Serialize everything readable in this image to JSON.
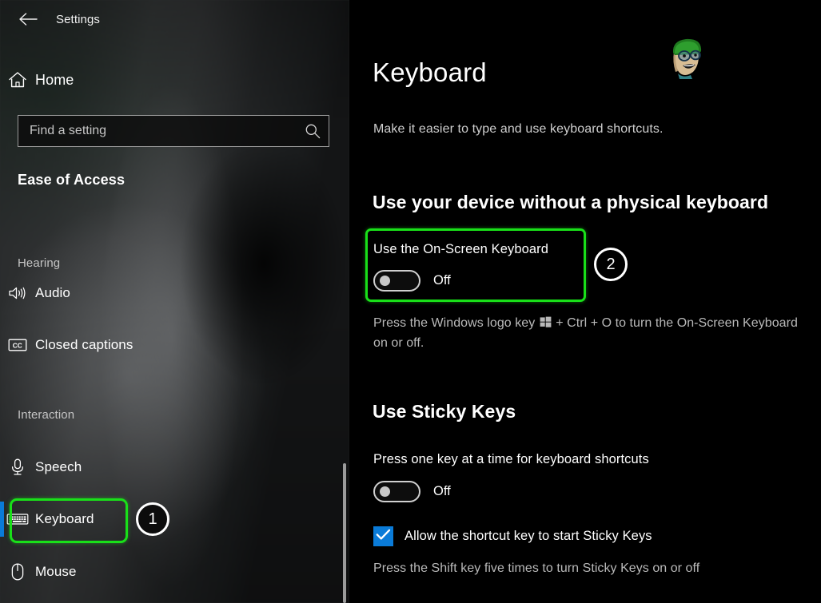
{
  "window": {
    "app_title": "Settings",
    "back_icon": "back-arrow-icon"
  },
  "sidebar": {
    "home": {
      "label": "Home",
      "icon": "home-icon"
    },
    "search": {
      "value": "",
      "placeholder": "Find a setting",
      "icon": "search-icon"
    },
    "category_title": "Ease of Access",
    "groups": [
      {
        "title": "Hearing",
        "items": [
          {
            "label": "Audio",
            "icon": "speaker-icon",
            "selected": false
          },
          {
            "label": "Closed captions",
            "icon": "closed-captions-icon",
            "selected": false
          }
        ]
      },
      {
        "title": "Interaction",
        "items": [
          {
            "label": "Speech",
            "icon": "microphone-icon",
            "selected": false
          },
          {
            "label": "Keyboard",
            "icon": "keyboard-icon",
            "selected": true
          },
          {
            "label": "Mouse",
            "icon": "mouse-icon",
            "selected": false
          }
        ]
      }
    ]
  },
  "main": {
    "title": "Keyboard",
    "subtitle": "Make it easier to type and use keyboard shortcuts.",
    "avatar_icon": "user-avatar-icon",
    "sections": [
      {
        "heading": "Use your device without a physical keyboard",
        "setting_label": "Use the On-Screen Keyboard",
        "toggle_state": "Off",
        "hint_before": "Press the Windows logo key ",
        "hint_key_icon": "windows-logo-icon",
        "hint_after": " + Ctrl + O to turn the On-Screen Keyboard on or off."
      },
      {
        "heading": "Use Sticky Keys",
        "setting_label": "Press one key at a time for keyboard shortcuts",
        "toggle_state": "Off",
        "checkbox_label": "Allow the shortcut key to start Sticky Keys",
        "checkbox_checked": true,
        "hint": "Press the Shift key five times to turn Sticky Keys on or off"
      }
    ]
  },
  "annotations": {
    "badge_1": "1",
    "badge_2": "2",
    "highlight_color": "#19e019",
    "accent_color": "#0a7bd8"
  }
}
